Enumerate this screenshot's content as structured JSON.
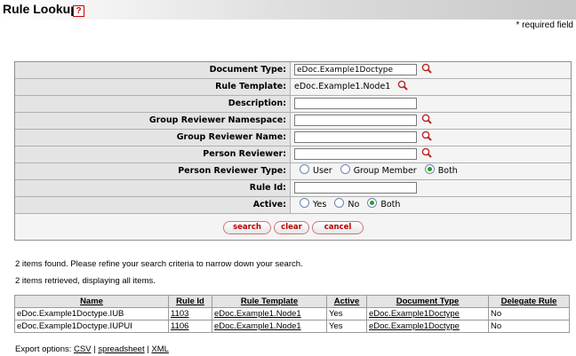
{
  "header": {
    "title": "Rule Lookup",
    "help_label": "?",
    "required_note": "* required field"
  },
  "criteria": [
    {
      "label": "Document Type:",
      "kind": "input",
      "value": "eDoc.Example1Doctype",
      "lookup": true
    },
    {
      "label": "Rule Template:",
      "kind": "static",
      "value": "eDoc.Example1.Node1",
      "lookup": true
    },
    {
      "label": "Description:",
      "kind": "input",
      "value": "",
      "lookup": false
    },
    {
      "label": "Group Reviewer Namespace:",
      "kind": "input",
      "value": "",
      "lookup": true
    },
    {
      "label": "Group Reviewer Name:",
      "kind": "input",
      "value": "",
      "lookup": true
    },
    {
      "label": "Person Reviewer:",
      "kind": "input",
      "value": "",
      "lookup": true
    },
    {
      "label": "Person Reviewer Type:",
      "kind": "radio",
      "options": [
        "User",
        "Group Member",
        "Both"
      ],
      "selected": "Both"
    },
    {
      "label": "Rule Id:",
      "kind": "input",
      "value": "",
      "lookup": false
    },
    {
      "label": "Active:",
      "kind": "radio",
      "options": [
        "Yes",
        "No",
        "Both"
      ],
      "selected": "Both"
    }
  ],
  "buttons": {
    "search": "search",
    "clear": "clear",
    "cancel": "cancel"
  },
  "messages": {
    "found": "2 items found. Please refine your search criteria to narrow down your search.",
    "retrieved": "2 items retrieved, displaying all items."
  },
  "results": {
    "columns": [
      "Name",
      "Rule Id",
      "Rule Template",
      "Active",
      "Document Type",
      "Delegate Rule"
    ],
    "rows": [
      [
        "eDoc.Example1Doctype.IUB",
        "1103",
        "eDoc.Example1.Node1",
        "Yes",
        "eDoc.Example1Doctype",
        "No"
      ],
      [
        "eDoc.Example1Doctype.IUPUI",
        "1106",
        "eDoc.Example1.Node1",
        "Yes",
        "eDoc.Example1Doctype",
        "No"
      ]
    ]
  },
  "export": {
    "label": "Export options:",
    "csv": "CSV",
    "spreadsheet": "spreadsheet",
    "xml": "XML"
  },
  "icons": {
    "lookup": "magnifier-icon",
    "help": "help-icon"
  },
  "colors": {
    "button_text": "#bb0000",
    "radio_selected": "#2a9a2a"
  }
}
